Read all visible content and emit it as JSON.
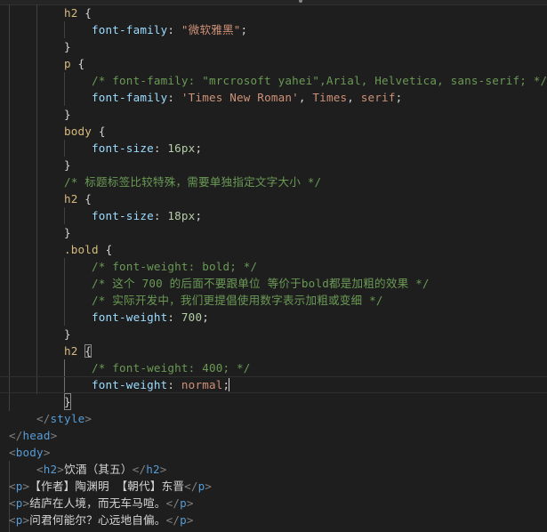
{
  "editor": {
    "language": "html",
    "theme_colors": {
      "background": "#1e1e1e",
      "selector": "#d7ba7d",
      "property": "#9cdcfe",
      "string": "#ce9178",
      "number": "#b5cea8",
      "comment": "#6a9955",
      "html_tag": "#569cd6"
    },
    "lines": {
      "l1_sel": "h2",
      "l1_brace": " {",
      "l2_prop": "font-family",
      "l2_colon": ": ",
      "l2_val": "\"微软雅黑\"",
      "l2_semi": ";",
      "l3": "}",
      "l4_sel": "p",
      "l4_brace": " {",
      "l5_com": "/* font-family: \"mrcrosoft yahei\",Arial, Helvetica, sans-serif; */",
      "l6_prop": "font-family",
      "l6_colon": ": ",
      "l6_val1": "'Times New Roman'",
      "l6_c1": ", ",
      "l6_val2": "Times",
      "l6_c2": ", ",
      "l6_val3": "serif",
      "l6_semi": ";",
      "l7": "}",
      "l8_sel": "body",
      "l8_brace": " {",
      "l9_prop": "font-size",
      "l9_colon": ": ",
      "l9_val": "16px",
      "l9_semi": ";",
      "l10": "}",
      "l11_com": "/* 标题标签比较特殊，需要单独指定文字大小 */",
      "l12_sel": "h2",
      "l12_brace": " {",
      "l13_prop": "font-size",
      "l13_colon": ": ",
      "l13_val": "18px",
      "l13_semi": ";",
      "l14": "}",
      "l15_sel": ".bold",
      "l15_brace": " {",
      "l16_com": "/* font-weight: bold; */",
      "l17_com": "/* 这个 700 的后面不要跟单位 等价于bold都是加粗的效果 */",
      "l18_com": "/* 实际开发中，我们更提倡使用数字表示加粗或变细 */",
      "l19_prop": "font-weight",
      "l19_colon": ": ",
      "l19_val": "700",
      "l19_semi": ";",
      "l20": "}",
      "l21_sel": "h2",
      "l21_space": " ",
      "l21_brace": "{",
      "l22_com": "/* font-weight: 400; */",
      "l23_prop": "font-weight",
      "l23_colon": ": ",
      "l23_val": "normal",
      "l23_semi": ";",
      "l24": "}",
      "l25_open": "</",
      "l25_tag": "style",
      "l25_close": ">",
      "l26_open": "</",
      "l26_tag": "head",
      "l26_close": ">",
      "l27_open": "<",
      "l27_tag": "body",
      "l27_close": ">",
      "l28_open": "<",
      "l28_tag": "h2",
      "l28_close": ">",
      "l28_text": "饮酒（其五）",
      "l28_eopen": "</",
      "l28_etag": "h2",
      "l28_eclose": ">",
      "l29_open": "<",
      "l29_tag": "p",
      "l29_close": ">",
      "l29_text": "【作者】陶渊明 【朝代】东晋",
      "l29_eopen": "</",
      "l29_etag": "p",
      "l29_eclose": ">",
      "l30_open": "<",
      "l30_tag": "p",
      "l30_close": ">",
      "l30_text": "结庐在人境，而无车马喧。",
      "l30_eopen": "</",
      "l30_etag": "p",
      "l30_eclose": ">",
      "l31_open": "<",
      "l31_tag": "p",
      "l31_close": ">",
      "l31_text": "问君何能尔？心远地自偏。",
      "l31_eopen": "</",
      "l31_etag": "p",
      "l31_eclose": ">"
    }
  }
}
